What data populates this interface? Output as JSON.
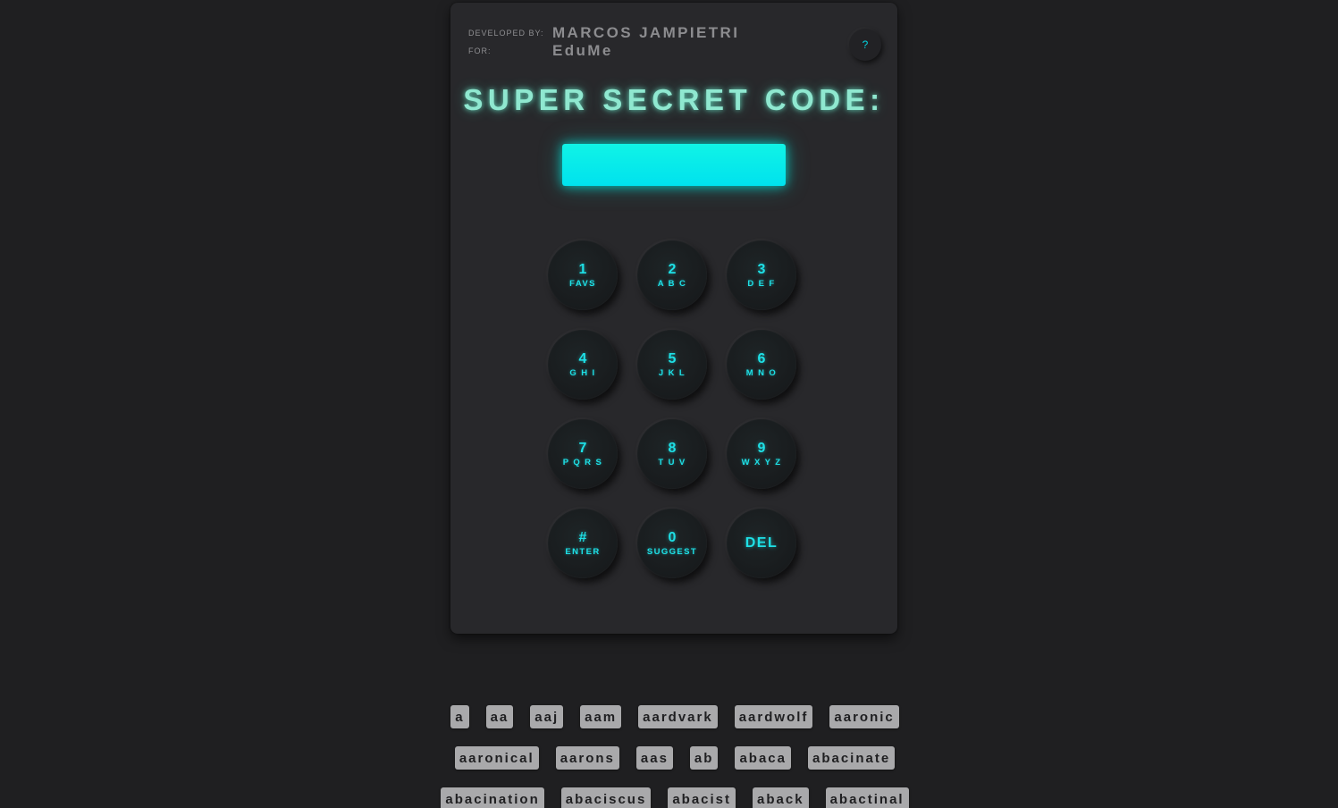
{
  "credits": {
    "developed_by_label": "DEVELOPED BY:",
    "developer_name": "MARCOS JAMPIETRI",
    "for_label": "FOR:",
    "client_name": "EduMe"
  },
  "help_button": {
    "label": "?"
  },
  "title": "SUPER SECRET CODE:",
  "code_display": {
    "value": ""
  },
  "keys": [
    {
      "digit": "1",
      "letters": "FAVS"
    },
    {
      "digit": "2",
      "letters": "A B C"
    },
    {
      "digit": "3",
      "letters": "D E F"
    },
    {
      "digit": "4",
      "letters": "G H I"
    },
    {
      "digit": "5",
      "letters": "J K L"
    },
    {
      "digit": "6",
      "letters": "M N O"
    },
    {
      "digit": "7",
      "letters": "P Q R S"
    },
    {
      "digit": "8",
      "letters": "T U V"
    },
    {
      "digit": "9",
      "letters": "W X Y Z"
    },
    {
      "digit": "#",
      "letters": "ENTER"
    },
    {
      "digit": "0",
      "letters": "SUGGEST"
    },
    {
      "label": "DEL"
    }
  ],
  "suggestions": [
    [
      "a",
      "aa",
      "aaj",
      "aam",
      "aardvark",
      "aardwolf",
      "aaronic"
    ],
    [
      "aaronical",
      "aarons",
      "aas",
      "ab",
      "abaca",
      "abacinate"
    ],
    [
      "abacination",
      "abaciscus",
      "abacist",
      "aback",
      "abactinal"
    ]
  ],
  "colors": {
    "background": "#1f1f21",
    "panel": "#28282b",
    "accent_cyan": "#1ee0e6",
    "title_glow": "#8fe8d0",
    "chip": "#a9a9ab"
  }
}
